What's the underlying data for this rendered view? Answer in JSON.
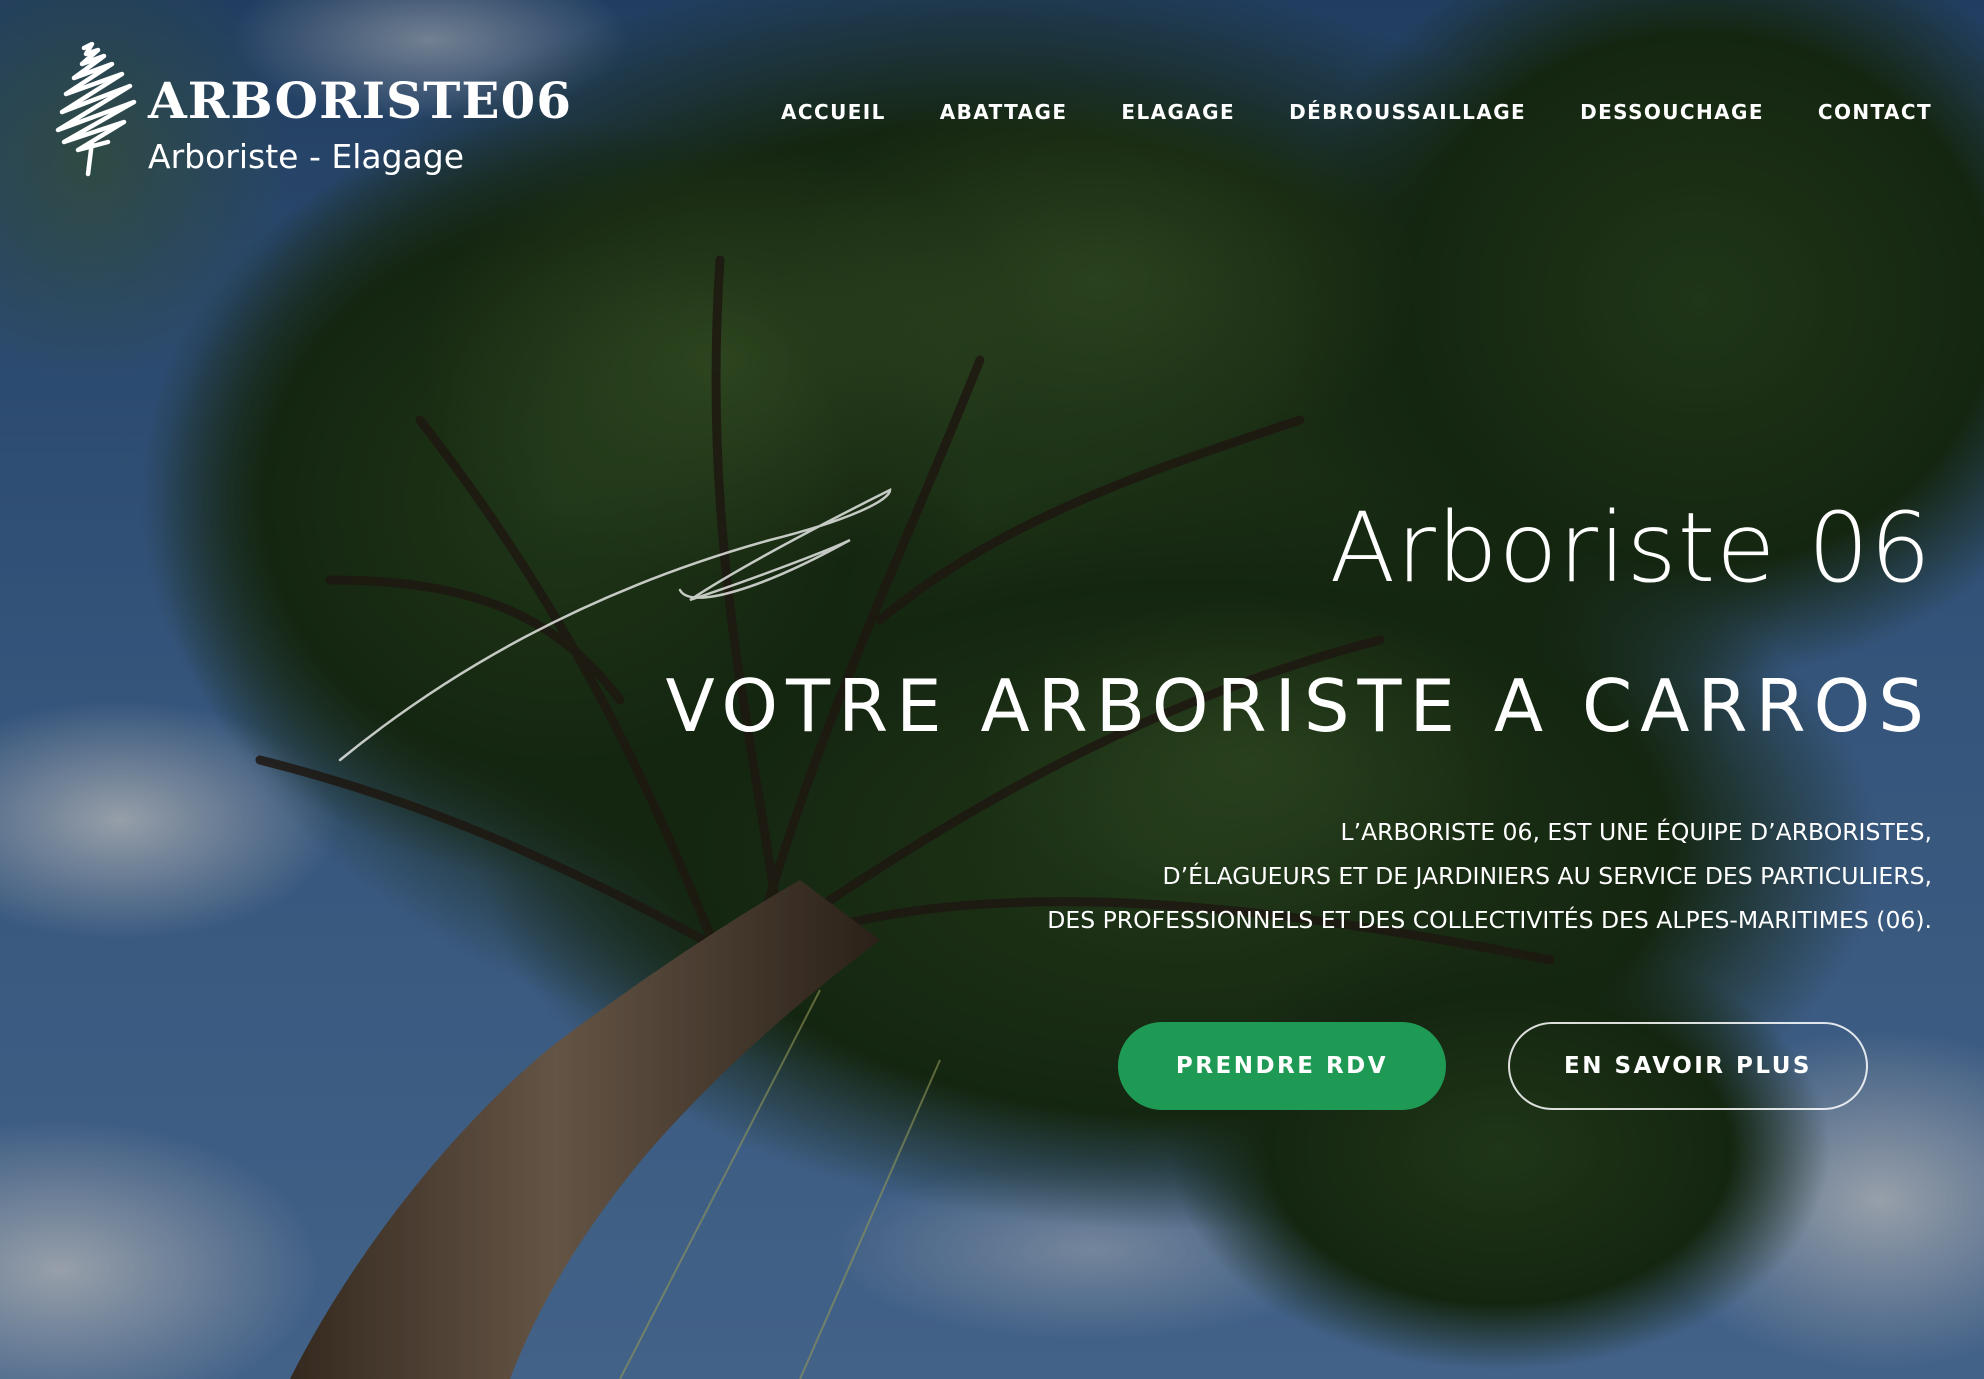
{
  "logo": {
    "title": "ARBORISTE06",
    "subtitle": "Arboriste - Elagage"
  },
  "nav": {
    "items": [
      {
        "label": "ACCUEIL"
      },
      {
        "label": "ABATTAGE"
      },
      {
        "label": "ELAGAGE"
      },
      {
        "label": "DÉBROUSSAILLAGE"
      },
      {
        "label": "DESSOUCHAGE"
      },
      {
        "label": "CONTACT"
      }
    ]
  },
  "hero": {
    "kicker": "Arboriste 06",
    "title": "VOTRE ARBORISTE A CARROS",
    "description_lines": [
      "L’ARBORISTE 06, EST UNE ÉQUIPE D’ARBORISTES,",
      "D’ÉLAGUEURS ET DE JARDINIERS AU SERVICE DES PARTICULIERS,",
      "DES PROFESSIONNELS ET DES COLLECTIVITÉS DES ALPES-MARITIMES (06)."
    ],
    "primary_button": "PRENDRE RDV",
    "secondary_button": "EN SAVOIR PLUS"
  },
  "colors": {
    "primary_button": "#1f9a55",
    "text": "#ffffff",
    "sky": "#3e6a9e",
    "foliage": "#1f3d1f"
  },
  "icons": {
    "logo_mark": "tree-scribble-icon"
  }
}
